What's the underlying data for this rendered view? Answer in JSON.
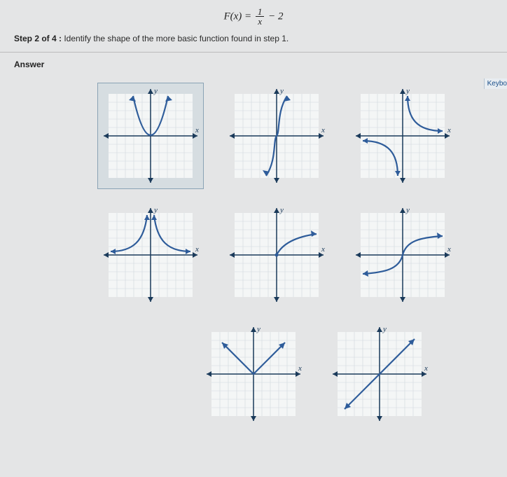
{
  "formula": {
    "lhs": "F(x)",
    "eq": "=",
    "num": "1",
    "den": "x",
    "tail": " − 2"
  },
  "step": {
    "prefix": "Step 2 of 4 :",
    "text": " Identify the shape of the more basic function found in step 1."
  },
  "answer_label": "Answer",
  "keyboard_label": "Keybo",
  "axis_x": "x",
  "axis_y": "y",
  "chart_data": [
    {
      "type": "line",
      "row": 1,
      "shape": "parabola",
      "desc": "y = x^2",
      "selected": true
    },
    {
      "type": "line",
      "row": 1,
      "shape": "cubic",
      "desc": "y = x^3",
      "selected": false
    },
    {
      "type": "line",
      "row": 1,
      "shape": "reciprocal",
      "desc": "y = 1/x",
      "selected": false
    },
    {
      "type": "line",
      "row": 2,
      "shape": "reciprocal_sq",
      "desc": "y = 1/x^2",
      "selected": false
    },
    {
      "type": "line",
      "row": 2,
      "shape": "sqrt",
      "desc": "y = sqrt(x)",
      "selected": false
    },
    {
      "type": "line",
      "row": 2,
      "shape": "cbrt",
      "desc": "y = cbrt(x)",
      "selected": false
    },
    {
      "type": "line",
      "row": 3,
      "shape": "abs",
      "desc": "y = |x|",
      "selected": false
    },
    {
      "type": "line",
      "row": 3,
      "shape": "identity",
      "desc": "y = x",
      "selected": false
    }
  ]
}
